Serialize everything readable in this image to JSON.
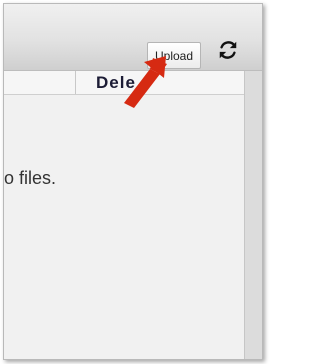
{
  "toolbar": {
    "upload_label": "Upload",
    "refresh_icon": "refresh-icon"
  },
  "table": {
    "columns": [
      "Dele"
    ]
  },
  "content": {
    "empty_message": "o files."
  },
  "annotation": {
    "arrow_color": "#d62a12"
  }
}
